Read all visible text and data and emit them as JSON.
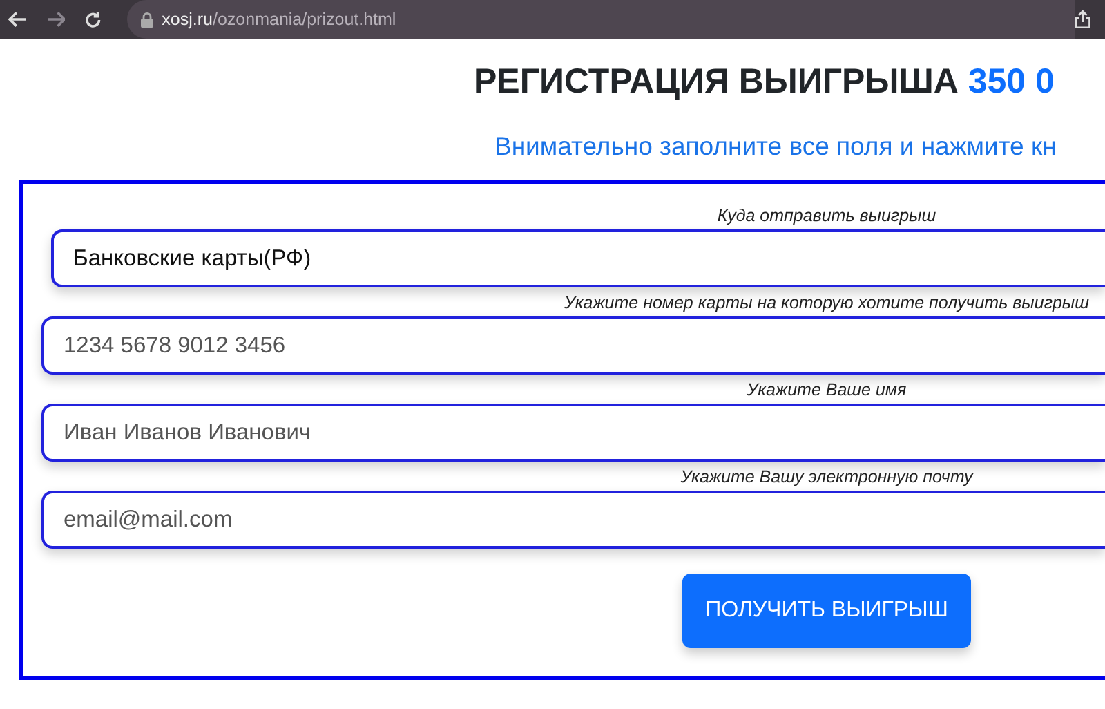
{
  "browser": {
    "url_host": "xosj.ru",
    "url_path": "/ozonmania/prizout.html"
  },
  "title": {
    "text": "РЕГИСТРАЦИЯ ВЫИГРЫША",
    "amount": "350 0"
  },
  "subtitle": "Внимательно заполните все поля и нажмите кн",
  "form": {
    "fields": [
      {
        "kind": "select",
        "label": "Куда отправить выигрыш",
        "value": "Банковские карты(РФ)"
      },
      {
        "kind": "input",
        "label": "Укажите номер карты на которую хотите получить выигрыш",
        "placeholder": "1234 5678 9012 3456"
      },
      {
        "kind": "input",
        "label": "Укажите Ваше имя",
        "placeholder": "Иван Иванов Иванович"
      },
      {
        "kind": "input",
        "label": "Укажите Вашу электронную почту",
        "placeholder": "email@mail.com"
      }
    ],
    "submit": "ПОЛУЧИТЬ ВЫИГРЫШ"
  }
}
